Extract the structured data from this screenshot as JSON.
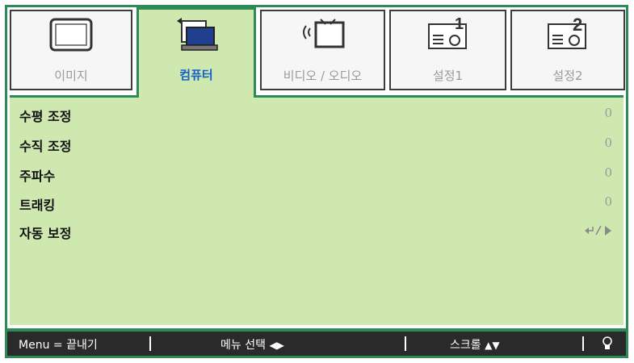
{
  "tabs": [
    {
      "label": "이미지",
      "icon": "image-icon",
      "active": false
    },
    {
      "label": "컴퓨터",
      "icon": "computer-icon",
      "active": true
    },
    {
      "label": "비디오 / 오디오",
      "icon": "video-audio-icon",
      "active": false
    },
    {
      "label": "설정1",
      "icon": "setup1-icon",
      "active": false
    },
    {
      "label": "설정2",
      "icon": "setup2-icon",
      "active": false
    }
  ],
  "menu": {
    "items": [
      {
        "label": "수평 조정",
        "value": "0"
      },
      {
        "label": "수직 조정",
        "value": "0"
      },
      {
        "label": "주파수",
        "value": "0"
      },
      {
        "label": "트래킹",
        "value": "0"
      },
      {
        "label": "자동 보정",
        "value": "",
        "icon": "enter-arrow-icon"
      }
    ]
  },
  "statusbar": {
    "menu_exit": "Menu = 끝내기",
    "menu_select": "메뉴 선택",
    "scroll": "스크롤",
    "info_icon": "bulb-icon"
  },
  "colors": {
    "accent": "#2e8b57",
    "panel": "#cfe8b0",
    "active_label": "#1560c8"
  }
}
